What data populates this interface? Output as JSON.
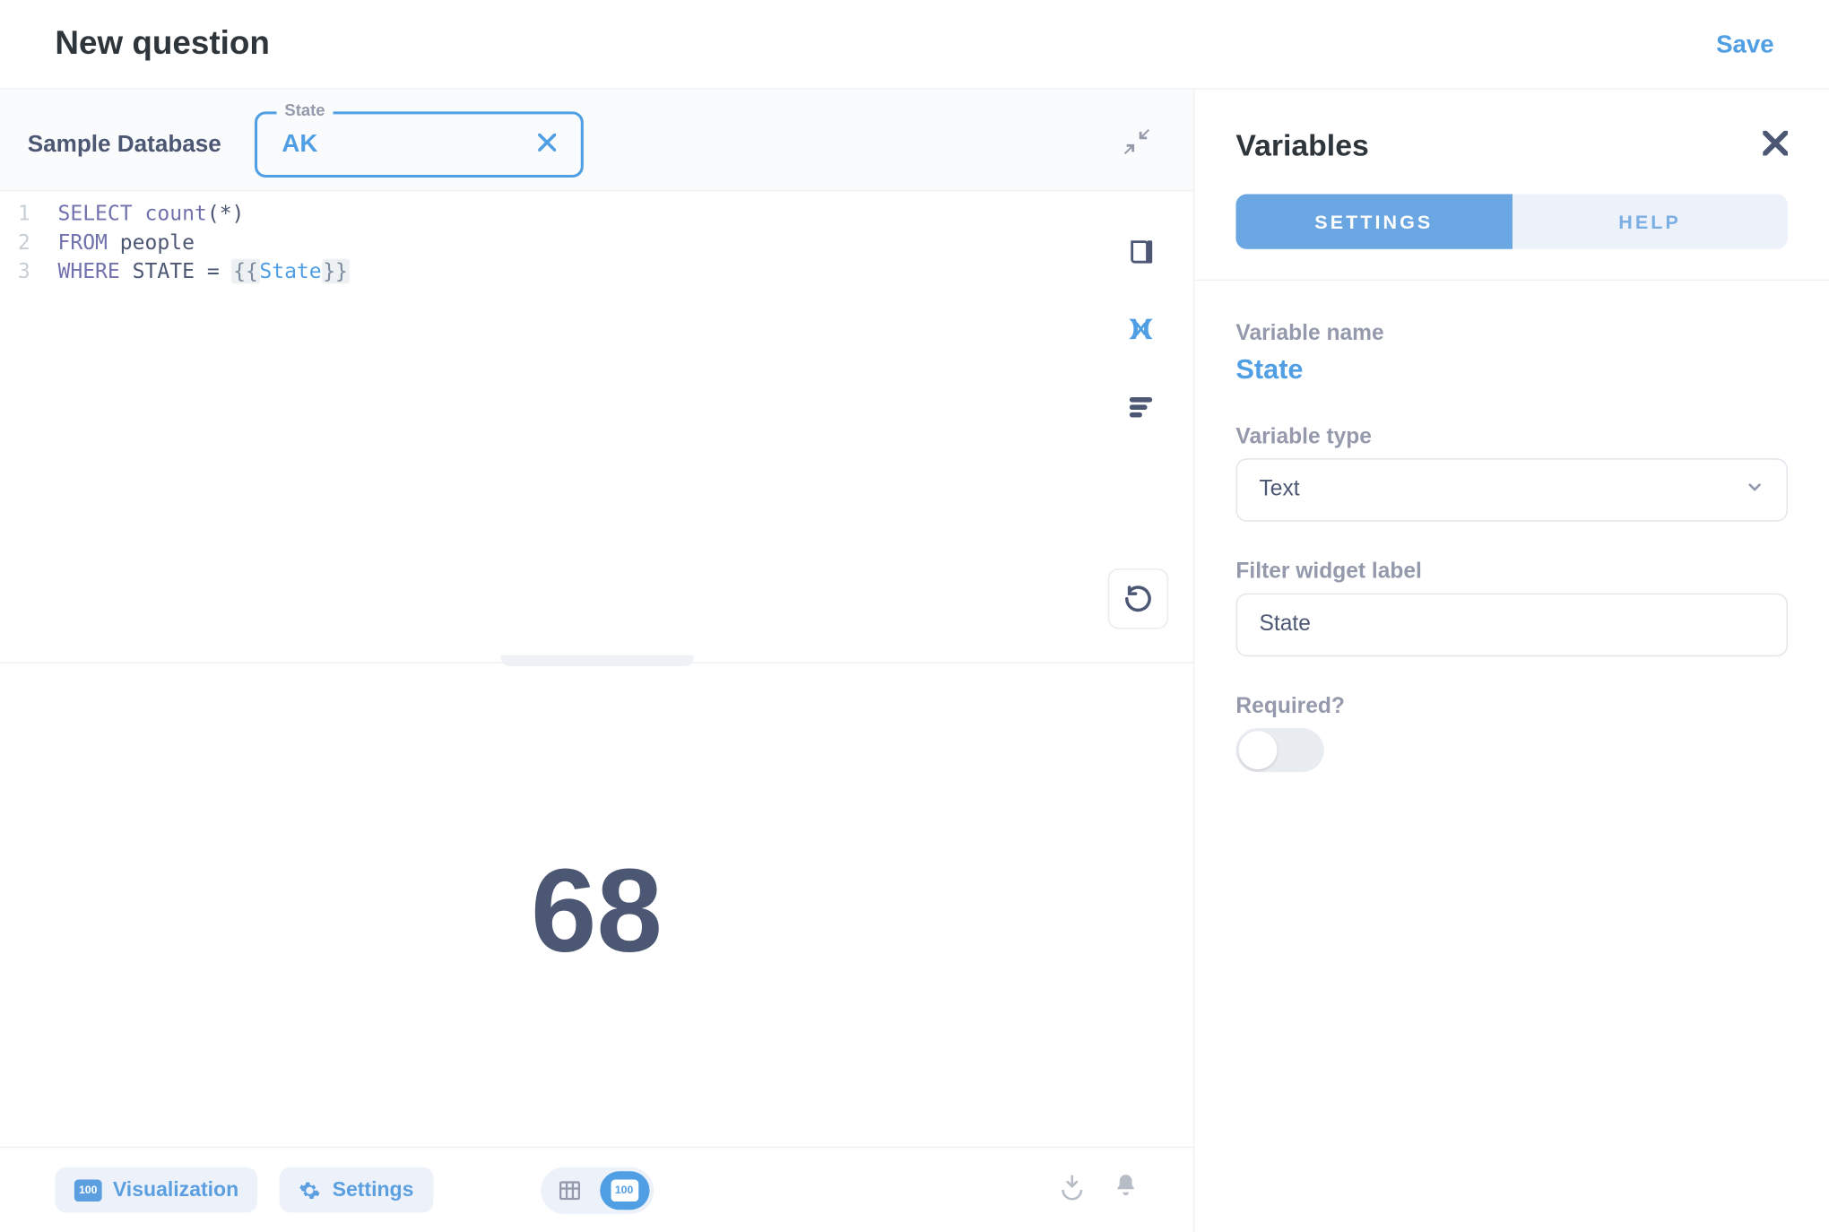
{
  "header": {
    "title": "New question",
    "save": "Save"
  },
  "query_bar": {
    "database": "Sample Database",
    "filter": {
      "legend": "State",
      "value": "AK"
    }
  },
  "editor": {
    "gutter": [
      "1",
      "2",
      "3"
    ],
    "line1": {
      "kw1": "SELECT",
      "fn": "count",
      "rest": "(*)"
    },
    "line2": {
      "kw1": "FROM",
      "id": "people"
    },
    "line3": {
      "kw1": "WHERE",
      "id": "STATE",
      "eq": "=",
      "braceL": "{{",
      "var": "State",
      "braceR": "}}"
    },
    "icons": {
      "reference": "data-reference-icon",
      "variables": "variable-icon",
      "snippets": "snippets-icon",
      "run": "refresh-icon"
    }
  },
  "result": {
    "value": "68"
  },
  "footer": {
    "viz": "Visualization",
    "settings": "Settings"
  },
  "right": {
    "title": "Variables",
    "tabs": {
      "settings": "SETTINGS",
      "help": "HELP"
    },
    "variable_name_label": "Variable name",
    "variable_name_value": "State",
    "variable_type_label": "Variable type",
    "variable_type_value": "Text",
    "filter_widget_label": "Filter widget label",
    "filter_widget_value": "State",
    "required_label": "Required?"
  }
}
